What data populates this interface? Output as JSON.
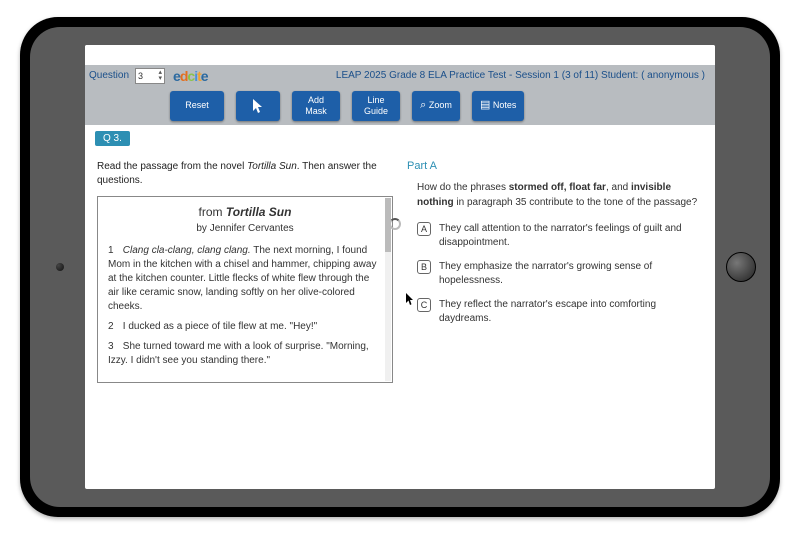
{
  "header": {
    "question_label": "Question",
    "question_number": "3",
    "logo_text": "edcite",
    "title": "LEAP 2025 Grade 8 ELA Practice Test - Session 1 (3 of 11) Student: ( anonymous )"
  },
  "toolbar": {
    "reset": "Reset",
    "cursor_glyph": "➦",
    "add_mask": "Add Mask",
    "line_guide": "Line Guide",
    "zoom": "Zoom",
    "zoom_icon": "⌕",
    "notes": "Notes",
    "notes_icon": "▤"
  },
  "badge": "Q 3.",
  "instruction_pre": "Read the passage from the novel ",
  "instruction_title": "Tortilla Sun",
  "instruction_post": ". Then answer the questions.",
  "passage": {
    "title_prefix": "from ",
    "title": "Tortilla Sun",
    "author": "by Jennifer Cervantes",
    "paras": [
      {
        "n": "1",
        "text_lead_italic": "Clang cla-clang, clang clang.",
        "text_rest": " The next morning, I found Mom in the kitchen with a chisel and hammer, chipping away at the kitchen counter. Little flecks of white flew through the air like ceramic snow, landing softly on her olive-colored cheeks."
      },
      {
        "n": "2",
        "text": "I ducked as a piece of tile flew at me. \"Hey!\""
      },
      {
        "n": "3",
        "text": "She turned toward me with a look of surprise. \"Morning, Izzy. I didn't see you standing there.\""
      }
    ]
  },
  "partA": {
    "label": "Part A",
    "q_pre": "How do the phrases ",
    "b1": "stormed off, float far",
    "q_mid1": ", and ",
    "b2": "invisible nothing",
    "q_mid2": " in paragraph 35 contribute to the tone of the passage?",
    "choices": [
      {
        "letter": "A",
        "text": "They call attention to the narrator's feelings of guilt and disappointment."
      },
      {
        "letter": "B",
        "text": "They emphasize the narrator's growing sense of hopelessness."
      },
      {
        "letter": "C",
        "text": "They reflect the narrator's escape into comforting daydreams."
      }
    ]
  }
}
